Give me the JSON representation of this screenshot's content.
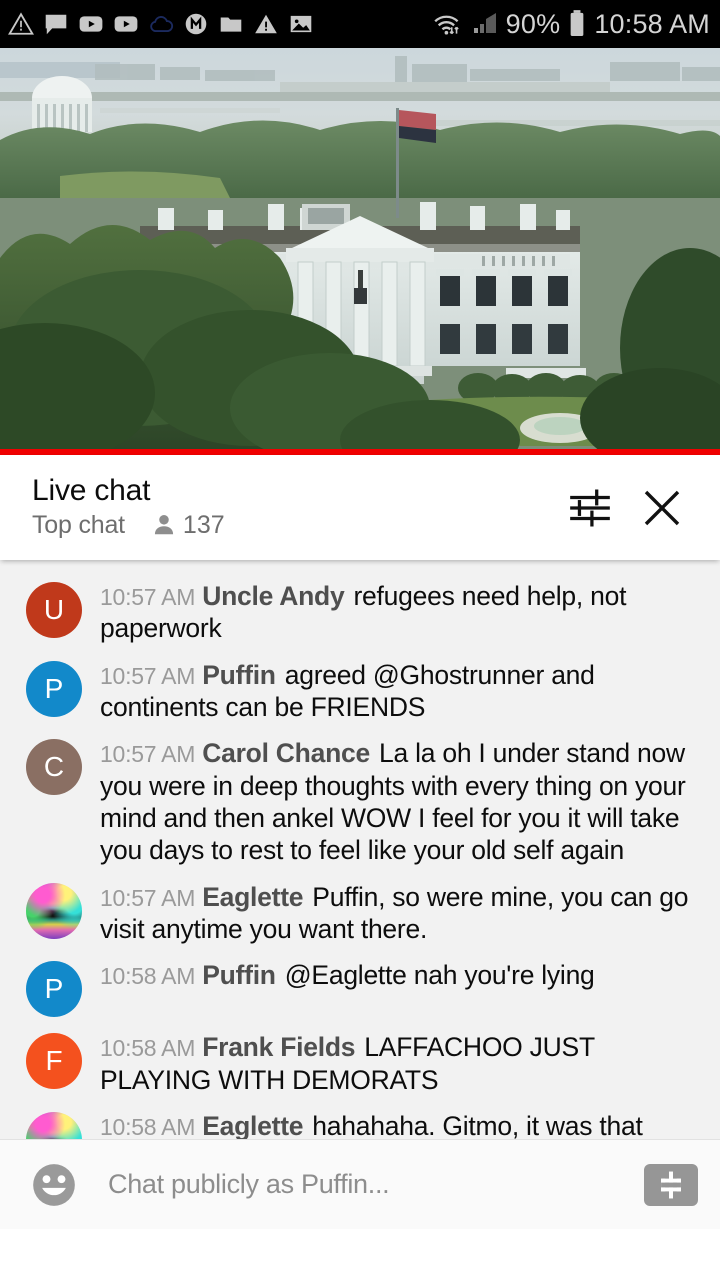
{
  "status_bar": {
    "battery_percent": "90%",
    "clock": "10:58 AM",
    "left_icons": [
      "warning-triangle-icon",
      "message-bubble-icon",
      "youtube-play-icon",
      "youtube-play-icon",
      "cloud-outline-icon",
      "m-badge-icon",
      "folder-icon",
      "warning-triangle-icon",
      "image-icon"
    ],
    "right_icons": [
      "wifi-transfer-icon",
      "cellular-signal-icon",
      "battery-icon"
    ],
    "background_color": "#000000",
    "text_color": "#d4d4d4"
  },
  "video": {
    "scene": "white-house-live-stream",
    "progress_percent": 100,
    "progress_color": "#f00000"
  },
  "chat_header": {
    "title": "Live chat",
    "mode_label": "Top chat",
    "viewer_count": "137",
    "viewer_icon": "person-icon",
    "settings_icon": "sliders-settings-icon",
    "close_icon": "close-x-icon"
  },
  "messages": [
    {
      "time": "10:57 AM",
      "author": "Uncle Andy",
      "text": "refugees need help, not paperwork",
      "avatar_type": "initial",
      "initial": "U",
      "avatar_color": "#c0391b"
    },
    {
      "time": "10:57 AM",
      "author": "Puffin",
      "text": "agreed @Ghostrunner and continents can be FRIENDS",
      "avatar_type": "initial",
      "initial": "P",
      "avatar_color": "#1289ca"
    },
    {
      "time": "10:57 AM",
      "author": "Carol Chance",
      "text": "La la oh I under stand now you were in deep thoughts with every thing on your mind and then ankel WOW I feel for you it will take you days to rest to feel like your old self again",
      "avatar_type": "initial",
      "initial": "C",
      "avatar_color": "#8a6f63"
    },
    {
      "time": "10:57 AM",
      "author": "Eaglette",
      "text": "Puffin, so were mine, you can go visit anytime you want there.",
      "avatar_type": "photo",
      "initial": "",
      "avatar_color": "#c060c0"
    },
    {
      "time": "10:58 AM",
      "author": "Puffin",
      "text": "@Eaglette nah you're lying",
      "avatar_type": "initial",
      "initial": "P",
      "avatar_color": "#1289ca"
    },
    {
      "time": "10:58 AM",
      "author": "Frank Fields",
      "text": "LAFFACHOO JUST PLAYING WITH DEMORATS",
      "avatar_type": "initial",
      "initial": "F",
      "avatar_color": "#f4511e"
    },
    {
      "time": "10:58 AM",
      "author": "Eaglette",
      "text": "hahahaha. Gitmo, it was that detailed on video?",
      "avatar_type": "photo",
      "initial": "",
      "avatar_color": "#c060c0"
    }
  ],
  "input_bar": {
    "placeholder": "Chat publicly as Puffin...",
    "value": "",
    "emoji_icon": "emoji-smiley-icon",
    "superchat_icon": "dollar-superchat-icon"
  }
}
